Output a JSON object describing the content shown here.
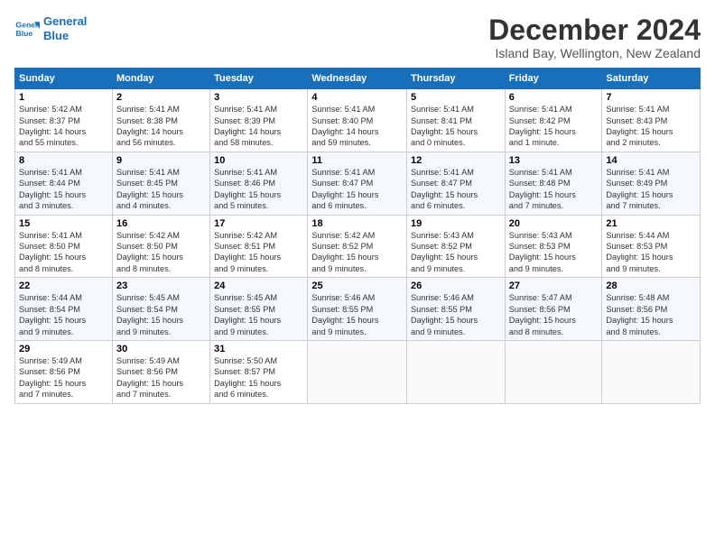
{
  "logo": {
    "line1": "General",
    "line2": "Blue"
  },
  "title": "December 2024",
  "subtitle": "Island Bay, Wellington, New Zealand",
  "days_of_week": [
    "Sunday",
    "Monday",
    "Tuesday",
    "Wednesday",
    "Thursday",
    "Friday",
    "Saturday"
  ],
  "weeks": [
    [
      {
        "day": "1",
        "info": "Sunrise: 5:42 AM\nSunset: 8:37 PM\nDaylight: 14 hours\nand 55 minutes."
      },
      {
        "day": "2",
        "info": "Sunrise: 5:41 AM\nSunset: 8:38 PM\nDaylight: 14 hours\nand 56 minutes."
      },
      {
        "day": "3",
        "info": "Sunrise: 5:41 AM\nSunset: 8:39 PM\nDaylight: 14 hours\nand 58 minutes."
      },
      {
        "day": "4",
        "info": "Sunrise: 5:41 AM\nSunset: 8:40 PM\nDaylight: 14 hours\nand 59 minutes."
      },
      {
        "day": "5",
        "info": "Sunrise: 5:41 AM\nSunset: 8:41 PM\nDaylight: 15 hours\nand 0 minutes."
      },
      {
        "day": "6",
        "info": "Sunrise: 5:41 AM\nSunset: 8:42 PM\nDaylight: 15 hours\nand 1 minute."
      },
      {
        "day": "7",
        "info": "Sunrise: 5:41 AM\nSunset: 8:43 PM\nDaylight: 15 hours\nand 2 minutes."
      }
    ],
    [
      {
        "day": "8",
        "info": "Sunrise: 5:41 AM\nSunset: 8:44 PM\nDaylight: 15 hours\nand 3 minutes."
      },
      {
        "day": "9",
        "info": "Sunrise: 5:41 AM\nSunset: 8:45 PM\nDaylight: 15 hours\nand 4 minutes."
      },
      {
        "day": "10",
        "info": "Sunrise: 5:41 AM\nSunset: 8:46 PM\nDaylight: 15 hours\nand 5 minutes."
      },
      {
        "day": "11",
        "info": "Sunrise: 5:41 AM\nSunset: 8:47 PM\nDaylight: 15 hours\nand 6 minutes."
      },
      {
        "day": "12",
        "info": "Sunrise: 5:41 AM\nSunset: 8:47 PM\nDaylight: 15 hours\nand 6 minutes."
      },
      {
        "day": "13",
        "info": "Sunrise: 5:41 AM\nSunset: 8:48 PM\nDaylight: 15 hours\nand 7 minutes."
      },
      {
        "day": "14",
        "info": "Sunrise: 5:41 AM\nSunset: 8:49 PM\nDaylight: 15 hours\nand 7 minutes."
      }
    ],
    [
      {
        "day": "15",
        "info": "Sunrise: 5:41 AM\nSunset: 8:50 PM\nDaylight: 15 hours\nand 8 minutes."
      },
      {
        "day": "16",
        "info": "Sunrise: 5:42 AM\nSunset: 8:50 PM\nDaylight: 15 hours\nand 8 minutes."
      },
      {
        "day": "17",
        "info": "Sunrise: 5:42 AM\nSunset: 8:51 PM\nDaylight: 15 hours\nand 9 minutes."
      },
      {
        "day": "18",
        "info": "Sunrise: 5:42 AM\nSunset: 8:52 PM\nDaylight: 15 hours\nand 9 minutes."
      },
      {
        "day": "19",
        "info": "Sunrise: 5:43 AM\nSunset: 8:52 PM\nDaylight: 15 hours\nand 9 minutes."
      },
      {
        "day": "20",
        "info": "Sunrise: 5:43 AM\nSunset: 8:53 PM\nDaylight: 15 hours\nand 9 minutes."
      },
      {
        "day": "21",
        "info": "Sunrise: 5:44 AM\nSunset: 8:53 PM\nDaylight: 15 hours\nand 9 minutes."
      }
    ],
    [
      {
        "day": "22",
        "info": "Sunrise: 5:44 AM\nSunset: 8:54 PM\nDaylight: 15 hours\nand 9 minutes."
      },
      {
        "day": "23",
        "info": "Sunrise: 5:45 AM\nSunset: 8:54 PM\nDaylight: 15 hours\nand 9 minutes."
      },
      {
        "day": "24",
        "info": "Sunrise: 5:45 AM\nSunset: 8:55 PM\nDaylight: 15 hours\nand 9 minutes."
      },
      {
        "day": "25",
        "info": "Sunrise: 5:46 AM\nSunset: 8:55 PM\nDaylight: 15 hours\nand 9 minutes."
      },
      {
        "day": "26",
        "info": "Sunrise: 5:46 AM\nSunset: 8:55 PM\nDaylight: 15 hours\nand 9 minutes."
      },
      {
        "day": "27",
        "info": "Sunrise: 5:47 AM\nSunset: 8:56 PM\nDaylight: 15 hours\nand 8 minutes."
      },
      {
        "day": "28",
        "info": "Sunrise: 5:48 AM\nSunset: 8:56 PM\nDaylight: 15 hours\nand 8 minutes."
      }
    ],
    [
      {
        "day": "29",
        "info": "Sunrise: 5:49 AM\nSunset: 8:56 PM\nDaylight: 15 hours\nand 7 minutes."
      },
      {
        "day": "30",
        "info": "Sunrise: 5:49 AM\nSunset: 8:56 PM\nDaylight: 15 hours\nand 7 minutes."
      },
      {
        "day": "31",
        "info": "Sunrise: 5:50 AM\nSunset: 8:57 PM\nDaylight: 15 hours\nand 6 minutes."
      },
      {
        "day": "",
        "info": ""
      },
      {
        "day": "",
        "info": ""
      },
      {
        "day": "",
        "info": ""
      },
      {
        "day": "",
        "info": ""
      }
    ]
  ]
}
